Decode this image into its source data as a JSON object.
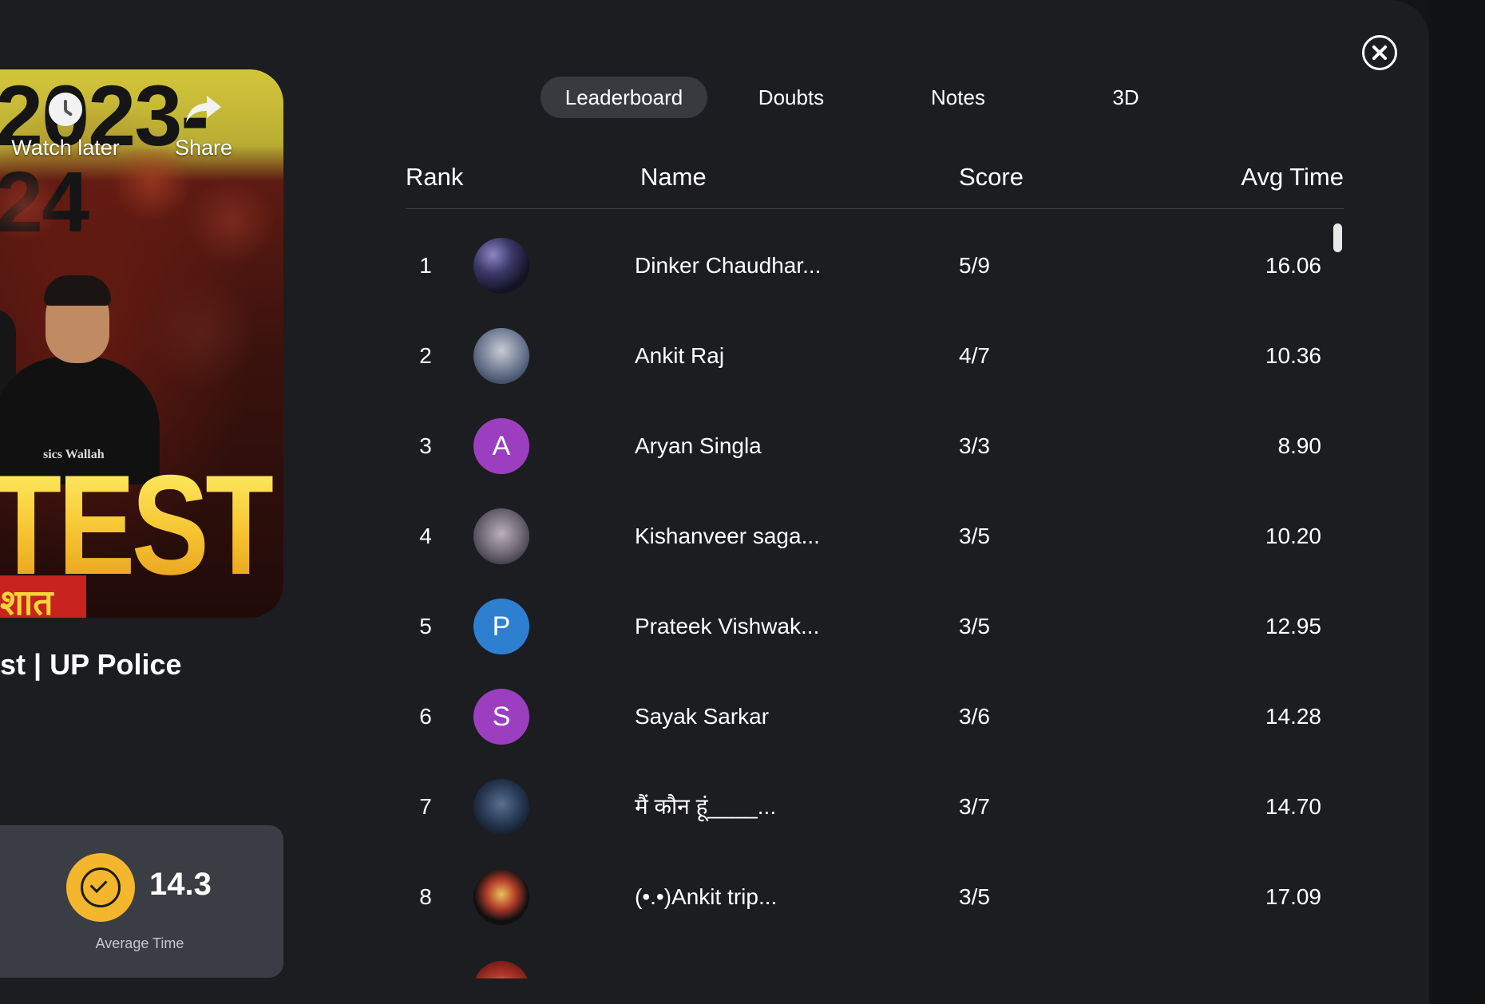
{
  "thumbnail": {
    "year_text": "2023-24",
    "big_text": "TEST",
    "hindi_text": "शात",
    "brand_text": "sics Wallah",
    "watch_later_label": "Watch later",
    "share_label": "Share"
  },
  "video_title": "st | UP Police",
  "average_time": {
    "value": "14.3",
    "label": "Average Time"
  },
  "tabs": [
    {
      "label": "Leaderboard",
      "active": true
    },
    {
      "label": "Doubts",
      "active": false
    },
    {
      "label": "Notes",
      "active": false
    },
    {
      "label": "3D",
      "active": false
    }
  ],
  "table": {
    "headers": {
      "rank": "Rank",
      "name": "Name",
      "score": "Score",
      "avg_time": "Avg Time"
    },
    "rows": [
      {
        "rank": "1",
        "name": "Dinker Chaudhar...",
        "score": "5/9",
        "avg_time": "16.06",
        "avatar": "photo"
      },
      {
        "rank": "2",
        "name": "Ankit Raj",
        "score": "4/7",
        "avg_time": "10.36",
        "avatar": "photo"
      },
      {
        "rank": "3",
        "name": "Aryan Singla",
        "score": "3/3",
        "avg_time": "8.90",
        "avatar_letter": "A",
        "avatar_color": "#9b3fc0"
      },
      {
        "rank": "4",
        "name": "Kishanveer saga...",
        "score": "3/5",
        "avg_time": "10.20",
        "avatar": "photo"
      },
      {
        "rank": "5",
        "name": "Prateek Vishwak...",
        "score": "3/5",
        "avg_time": "12.95",
        "avatar_letter": "P",
        "avatar_color": "#2f7fd0"
      },
      {
        "rank": "6",
        "name": "Sayak Sarkar",
        "score": "3/6",
        "avg_time": "14.28",
        "avatar_letter": "S",
        "avatar_color": "#9b3fc0"
      },
      {
        "rank": "7",
        "name": "मैं कौन हूं____...",
        "score": "3/7",
        "avg_time": "14.70",
        "avatar": "photo"
      },
      {
        "rank": "8",
        "name": "(•.•)Ankit trip...",
        "score": "3/5",
        "avg_time": "17.09",
        "avatar": "emblem"
      }
    ]
  },
  "icons": {
    "close": "close-circle-icon",
    "watch_later": "clock-icon",
    "share": "share-arrow-icon",
    "avg_time_badge": "check-circle-icon"
  },
  "colors": {
    "panel": "#1c1d21",
    "active_tab": "#383a40",
    "avg_card": "#3b3d44",
    "badge": "#f4b62d"
  }
}
